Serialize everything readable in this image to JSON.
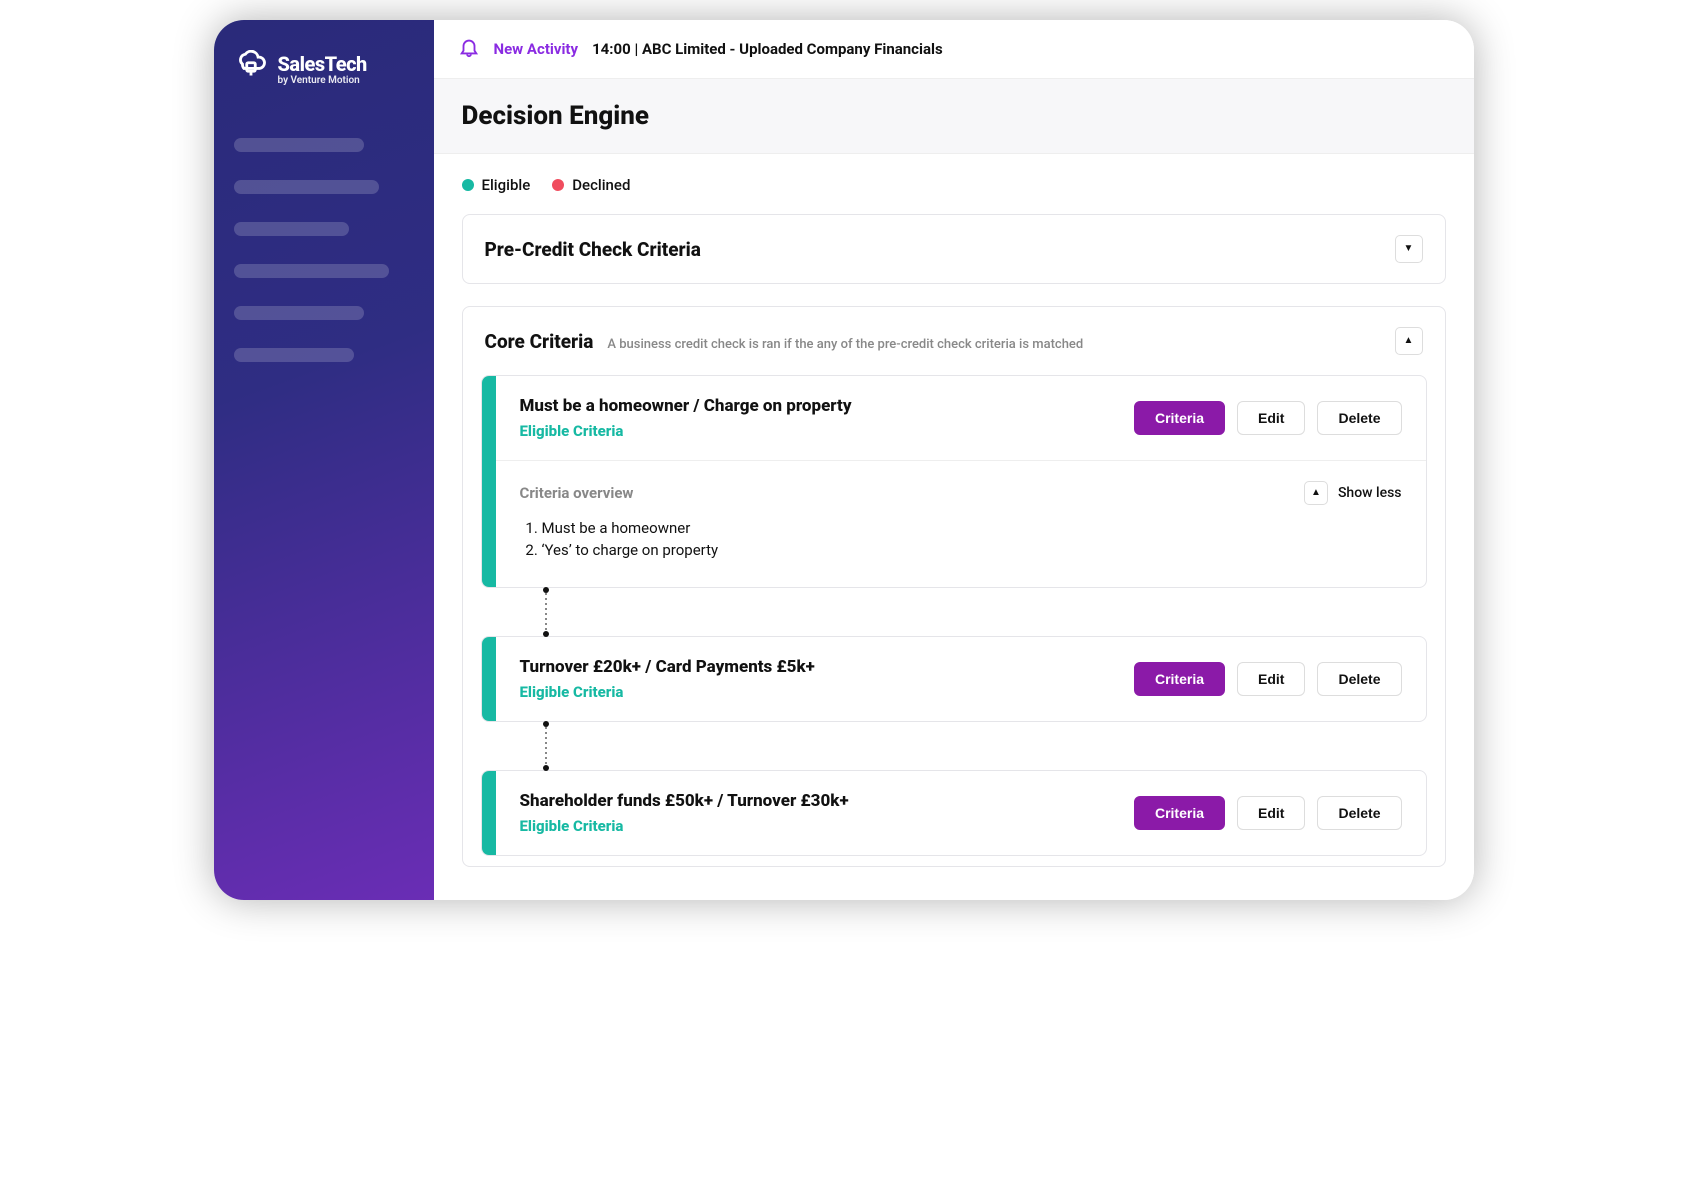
{
  "brand": {
    "title": "SalesTech",
    "subtitle": "by Venture Motion"
  },
  "topbar": {
    "new_activity_label": "New Activity",
    "activity_text": "14:00 | ABC Limited - Uploaded Company Financials"
  },
  "page": {
    "title": "Decision Engine"
  },
  "legend": {
    "eligible": "Eligible",
    "declined": "Declined"
  },
  "panels": {
    "pre_credit": {
      "title": "Pre-Credit Check Criteria"
    },
    "core": {
      "title": "Core Criteria",
      "subtitle": "A business credit check is ran if the any of the pre-credit check criteria is matched"
    }
  },
  "buttons": {
    "criteria": "Criteria",
    "edit": "Edit",
    "delete": "Delete",
    "show_less": "Show less"
  },
  "detail_title": "Criteria overview",
  "cards": [
    {
      "title": "Must be a homeowner / Charge on property",
      "tag": "Eligible Criteria",
      "overview": [
        "Must be a homeowner",
        "‘Yes’ to charge on property"
      ]
    },
    {
      "title": "Turnover £20k+ / Card Payments £5k+",
      "tag": "Eligible Criteria"
    },
    {
      "title": "Shareholder funds £50k+ / Turnover £30k+",
      "tag": "Eligible Criteria"
    }
  ],
  "colors": {
    "teal": "#17b9a3",
    "red": "#f04c5e",
    "purple": "#8b1aa8"
  }
}
